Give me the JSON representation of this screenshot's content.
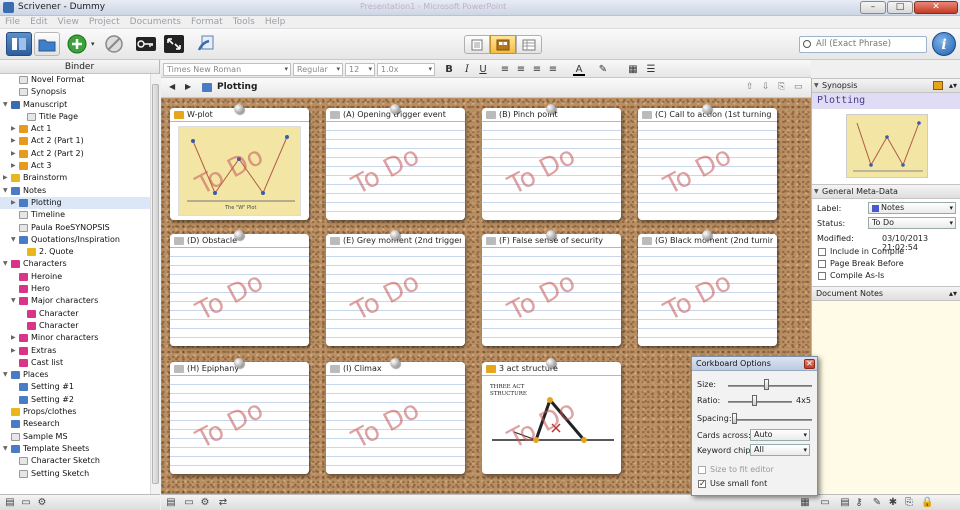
{
  "window": {
    "title": "Scrivener - Dummy",
    "ghost_title": "Presentation1 - Microsoft PowerPoint",
    "btn_min": "–",
    "btn_max": "□",
    "btn_close": "✕"
  },
  "menu": [
    "File",
    "Edit",
    "View",
    "Project",
    "Documents",
    "Format",
    "Tools",
    "Help"
  ],
  "search": {
    "placeholder": "All (Exact Phrase)"
  },
  "info_label": "i",
  "binder": {
    "title": "Binder",
    "items": [
      {
        "label": "Novel Format",
        "indent": 1,
        "icon": "doc",
        "tri": ""
      },
      {
        "label": "Synopsis",
        "indent": 1,
        "icon": "doc",
        "tri": ""
      },
      {
        "label": "Manuscript",
        "indent": 0,
        "icon": "book",
        "tri": "▼"
      },
      {
        "label": "Title Page",
        "indent": 2,
        "icon": "doc",
        "tri": ""
      },
      {
        "label": "Act 1",
        "indent": 1,
        "icon": "orange",
        "tri": "▶"
      },
      {
        "label": "Act 2 (Part 1)",
        "indent": 1,
        "icon": "orange",
        "tri": "▶"
      },
      {
        "label": "Act 2 (Part 2)",
        "indent": 1,
        "icon": "orange",
        "tri": "▶"
      },
      {
        "label": "Act 3",
        "indent": 1,
        "icon": "orange",
        "tri": "▶"
      },
      {
        "label": "Brainstorm",
        "indent": 0,
        "icon": "yellow",
        "tri": "▶"
      },
      {
        "label": "Notes",
        "indent": 0,
        "icon": "blue",
        "tri": "▼"
      },
      {
        "label": "Plotting",
        "indent": 1,
        "icon": "blue",
        "tri": "▶",
        "selected": true
      },
      {
        "label": "Timeline",
        "indent": 1,
        "icon": "doc",
        "tri": ""
      },
      {
        "label": "Paula RoeSYNOPSIS",
        "indent": 1,
        "icon": "doc",
        "tri": ""
      },
      {
        "label": "Quotations/Inspiration",
        "indent": 1,
        "icon": "blue",
        "tri": "▼"
      },
      {
        "label": "2. Quote",
        "indent": 2,
        "icon": "yellow",
        "tri": ""
      },
      {
        "label": "Characters",
        "indent": 0,
        "icon": "pink",
        "tri": "▼"
      },
      {
        "label": "Heroine",
        "indent": 1,
        "icon": "pink",
        "tri": ""
      },
      {
        "label": "Hero",
        "indent": 1,
        "icon": "pink",
        "tri": ""
      },
      {
        "label": "Major characters",
        "indent": 1,
        "icon": "pink",
        "tri": "▼"
      },
      {
        "label": "Character",
        "indent": 2,
        "icon": "pink",
        "tri": ""
      },
      {
        "label": "Character",
        "indent": 2,
        "icon": "pink",
        "tri": ""
      },
      {
        "label": "Minor characters",
        "indent": 1,
        "icon": "pink",
        "tri": "▶"
      },
      {
        "label": "Extras",
        "indent": 1,
        "icon": "pink",
        "tri": "▶"
      },
      {
        "label": "Cast list",
        "indent": 1,
        "icon": "pink",
        "tri": ""
      },
      {
        "label": "Places",
        "indent": 0,
        "icon": "blue",
        "tri": "▼"
      },
      {
        "label": "Setting #1",
        "indent": 1,
        "icon": "blue",
        "tri": ""
      },
      {
        "label": "Setting #2",
        "indent": 1,
        "icon": "blue",
        "tri": ""
      },
      {
        "label": "Props/clothes",
        "indent": 0,
        "icon": "yellow",
        "tri": ""
      },
      {
        "label": "Research",
        "indent": 0,
        "icon": "blue",
        "tri": ""
      },
      {
        "label": "Sample MS",
        "indent": 0,
        "icon": "doc",
        "tri": ""
      },
      {
        "label": "Template Sheets",
        "indent": 0,
        "icon": "blue",
        "tri": "▼"
      },
      {
        "label": "Character Sketch",
        "indent": 1,
        "icon": "doc",
        "tri": ""
      },
      {
        "label": "Setting Sketch",
        "indent": 1,
        "icon": "doc",
        "tri": ""
      }
    ]
  },
  "format": {
    "font": "Times New Roman",
    "style": "Regular",
    "size": "12",
    "spacing": "1.0x",
    "bold": "B",
    "italic": "I",
    "underline": "U"
  },
  "editor": {
    "title": "Plotting",
    "back": "◀",
    "forward": "▶"
  },
  "stamp": "To Do",
  "cards": [
    {
      "title": "W-plot",
      "icon": "yellow",
      "image": "wplot"
    },
    {
      "title": "(A) Opening trigger event",
      "icon": "grey"
    },
    {
      "title": "(B) Pinch point",
      "icon": "grey"
    },
    {
      "title": "(C) Call to action (1st turning ...",
      "icon": "grey"
    },
    {
      "title": "(D) Obstacle",
      "icon": "grey"
    },
    {
      "title": "(E) Grey moment (2nd trigger ...",
      "icon": "grey"
    },
    {
      "title": "(F) False sense of security",
      "icon": "grey"
    },
    {
      "title": "(G) Black moment (2nd turning...",
      "icon": "grey"
    },
    {
      "title": "(H) Epiphany",
      "icon": "grey"
    },
    {
      "title": "(I) Climax",
      "icon": "grey"
    },
    {
      "title": "3 act structure",
      "icon": "yellow",
      "image": "threeact"
    }
  ],
  "image_text": {
    "wplot_caption": "The \"W\" Plot",
    "threeact_title": "THREE ACT STRUCTURE"
  },
  "inspector": {
    "synopsis_header": "Synopsis",
    "synopsis_title": "Plotting",
    "meta_header": "General Meta-Data",
    "label_label": "Label:",
    "label_value": "Notes",
    "status_label": "Status:",
    "status_value": "To Do",
    "modified_label": "Modified:",
    "modified_value": "03/10/2013 21:02:54",
    "include_compile": "Include in Compile",
    "page_break": "Page Break Before",
    "compile_as_is": "Compile As-Is",
    "doc_notes_header": "Document Notes"
  },
  "cork_options": {
    "title": "Corkboard Options",
    "size_label": "Size:",
    "ratio_label": "Ratio:",
    "ratio_value": "4x5",
    "spacing_label": "Spacing:",
    "cards_across_label": "Cards across:",
    "cards_across_value": "Auto",
    "keyword_label": "Keyword chips:",
    "keyword_value": "All",
    "size_to_fit": "Size to fit editor",
    "small_font": "Use small font"
  },
  "colors": {
    "cork": "#b98e62",
    "stamp": "#c35555",
    "selection": "#dbe6f6",
    "accent": "#2d5f9c",
    "notes_bg": "#fffbe6"
  }
}
